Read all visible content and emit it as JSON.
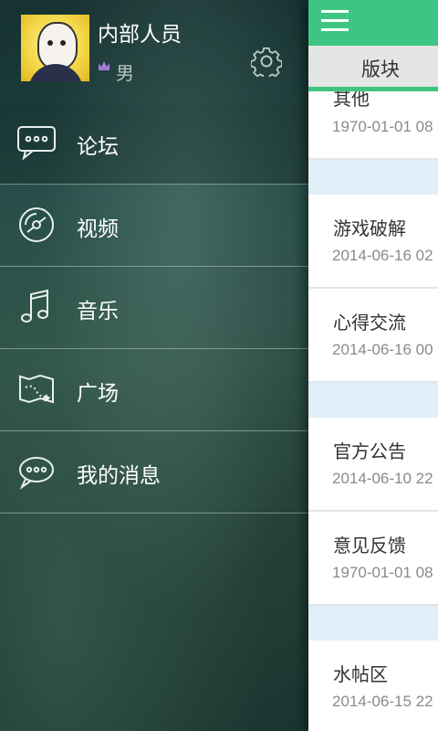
{
  "drawer": {
    "profile": {
      "username": "内部人员",
      "gender": "男",
      "crown_icon": "crown-icon",
      "settings_icon": "gear-icon"
    },
    "menu": [
      {
        "label": "论坛",
        "icon": "chat-bubble-icon"
      },
      {
        "label": "视频",
        "icon": "disc-icon"
      },
      {
        "label": "音乐",
        "icon": "music-note-icon"
      },
      {
        "label": "广场",
        "icon": "map-icon"
      },
      {
        "label": "我的消息",
        "icon": "message-icon"
      }
    ]
  },
  "panel": {
    "menu_icon": "hamburger-icon",
    "tab_label": "版块",
    "accent_color": "#3ec583",
    "items": [
      {
        "title": "其他",
        "date": "1970-01-01 08"
      },
      {
        "title": "游戏破解",
        "date": "2014-06-16 02"
      },
      {
        "title": "心得交流",
        "date": "2014-06-16 00"
      },
      {
        "title": "官方公告",
        "date": "2014-06-10 22"
      },
      {
        "title": "意见反馈",
        "date": "1970-01-01 08"
      },
      {
        "title": "水帖区",
        "date": "2014-06-15 22"
      }
    ]
  }
}
